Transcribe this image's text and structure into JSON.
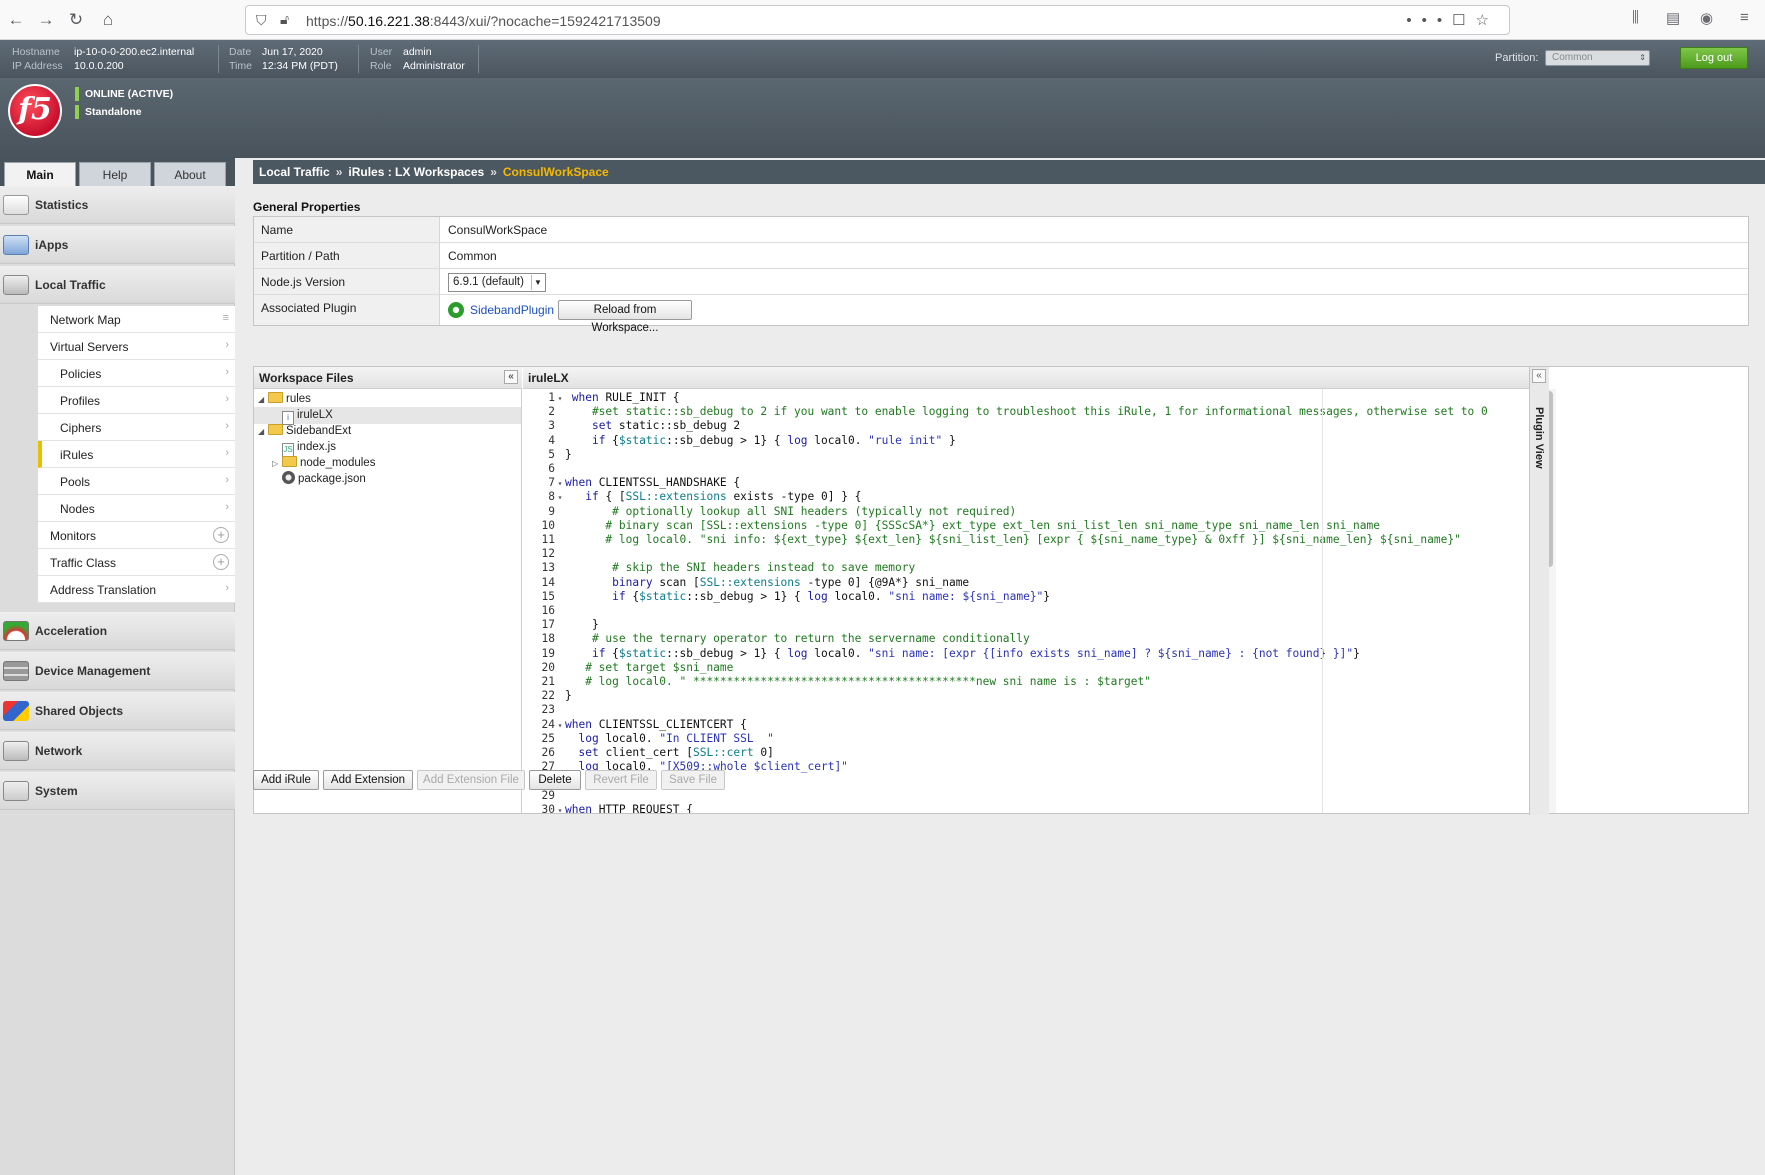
{
  "browser": {
    "url_prefix": "https://",
    "url_host": "50.16.221.38",
    "url_rest": ":8443/xui/?nocache=1592421713509",
    "icons": [
      "back-icon",
      "forward-icon",
      "reload-icon",
      "home-icon"
    ]
  },
  "infobar": {
    "hostname_label": "Hostname",
    "hostname": "ip-10-0-0-200.ec2.internal",
    "ip_label": "IP Address",
    "ip": "10.0.0.200",
    "date_label": "Date",
    "date": "Jun 17, 2020",
    "time_label": "Time",
    "time": "12:34 PM (PDT)",
    "user_label": "User",
    "user": "admin",
    "role_label": "Role",
    "role": "Administrator",
    "partition_label": "Partition:",
    "partition_value": "Common",
    "logout": "Log out"
  },
  "status": {
    "online": "ONLINE (ACTIVE)",
    "mode": "Standalone"
  },
  "logo_text": "f5",
  "tabs": [
    "Main",
    "Help",
    "About"
  ],
  "sidebar": {
    "sections": [
      "Statistics",
      "iApps",
      "Local Traffic",
      "Acceleration",
      "Device Management",
      "Shared Objects",
      "Network",
      "System"
    ],
    "local_traffic_items": [
      "Network Map",
      "Virtual Servers",
      "Policies",
      "Profiles",
      "Ciphers",
      "iRules",
      "Pools",
      "Nodes",
      "Monitors",
      "Traffic Class",
      "Address Translation"
    ]
  },
  "breadcrumb": {
    "part1": "Local Traffic",
    "part2": "iRules : LX Workspaces",
    "current": "ConsulWorkSpace",
    "sep": "»"
  },
  "general": {
    "title": "General Properties",
    "name_label": "Name",
    "name_value": "ConsulWorkSpace",
    "partition_label": "Partition / Path",
    "partition_value": "Common",
    "node_label": "Node.js Version",
    "node_value": "6.9.1 (default)",
    "plugin_label": "Associated Plugin",
    "plugin_value": "SidebandPlugin",
    "reload_button": "Reload from Workspace..."
  },
  "workspace": {
    "files_title": "Workspace Files",
    "editor_title": "iruleLX",
    "plugin_view": "Plugin View",
    "tree": [
      "rules",
      "iruleLX",
      "SidebandExt",
      "index.js",
      "node_modules",
      "package.json"
    ]
  },
  "code": [
    {
      "n": "1",
      "f": "▾",
      "t": " when RULE_INIT {"
    },
    {
      "n": "2",
      "f": "",
      "t": "    #set static::sb_debug to 2 if you want to enable logging to troubleshoot this iRule, 1 for informational messages, otherwise set to 0"
    },
    {
      "n": "3",
      "f": "",
      "t": "    set static::sb_debug 2"
    },
    {
      "n": "4",
      "f": "",
      "t": "    if {$static::sb_debug > 1} { log local0. \"rule init\" }"
    },
    {
      "n": "5",
      "f": "",
      "t": "}"
    },
    {
      "n": "6",
      "f": "",
      "t": ""
    },
    {
      "n": "7",
      "f": "▾",
      "t": "when CLIENTSSL_HANDSHAKE {"
    },
    {
      "n": "8",
      "f": "▾",
      "t": "   if { [SSL::extensions exists -type 0] } {"
    },
    {
      "n": "9",
      "f": "",
      "t": "       # optionally lookup all SNI headers (typically not required)"
    },
    {
      "n": "10",
      "f": "",
      "t": "      # binary scan [SSL::extensions -type 0] {SSScSA*} ext_type ext_len sni_list_len sni_name_type sni_name_len sni_name"
    },
    {
      "n": "11",
      "f": "",
      "t": "      # log local0. \"sni info: ${ext_type} ${ext_len} ${sni_list_len} [expr { ${sni_name_type} & 0xff }] ${sni_name_len} ${sni_name}\""
    },
    {
      "n": "12",
      "f": "",
      "t": ""
    },
    {
      "n": "13",
      "f": "",
      "t": "       # skip the SNI headers instead to save memory"
    },
    {
      "n": "14",
      "f": "",
      "t": "       binary scan [SSL::extensions -type 0] {@9A*} sni_name"
    },
    {
      "n": "15",
      "f": "",
      "t": "       if {$static::sb_debug > 1} { log local0. \"sni name: ${sni_name}\"}"
    },
    {
      "n": "16",
      "f": "",
      "t": ""
    },
    {
      "n": "17",
      "f": "",
      "t": "    }"
    },
    {
      "n": "18",
      "f": "",
      "t": "    # use the ternary operator to return the servername conditionally"
    },
    {
      "n": "19",
      "f": "",
      "t": "    if {$static::sb_debug > 1} { log local0. \"sni name: [expr {[info exists sni_name] ? ${sni_name} : {not found} }]\"}"
    },
    {
      "n": "20",
      "f": "",
      "t": "   # set target $sni_name"
    },
    {
      "n": "21",
      "f": "",
      "t": "   # log local0. \" ******************************************new sni name is : $target\""
    },
    {
      "n": "22",
      "f": "",
      "t": "}"
    },
    {
      "n": "23",
      "f": "",
      "t": ""
    },
    {
      "n": "24",
      "f": "▾",
      "t": "when CLIENTSSL_CLIENTCERT {"
    },
    {
      "n": "25",
      "f": "",
      "t": "  log local0. \"In CLIENT SSL  \""
    },
    {
      "n": "26",
      "f": "",
      "t": "  set client_cert [SSL::cert 0]"
    },
    {
      "n": "27",
      "f": "",
      "t": "  log local0. \"[X509::whole $client_cert]\""
    },
    {
      "n": "28",
      "f": "",
      "t": "}"
    },
    {
      "n": "29",
      "f": "",
      "t": ""
    },
    {
      "n": "30",
      "f": "▾",
      "t": "when HTTP_REQUEST {"
    }
  ],
  "buttons": {
    "add_irule": "Add iRule",
    "add_extension": "Add Extension",
    "add_extension_file": "Add Extension File",
    "delete": "Delete",
    "revert_file": "Revert File",
    "save_file": "Save File"
  }
}
